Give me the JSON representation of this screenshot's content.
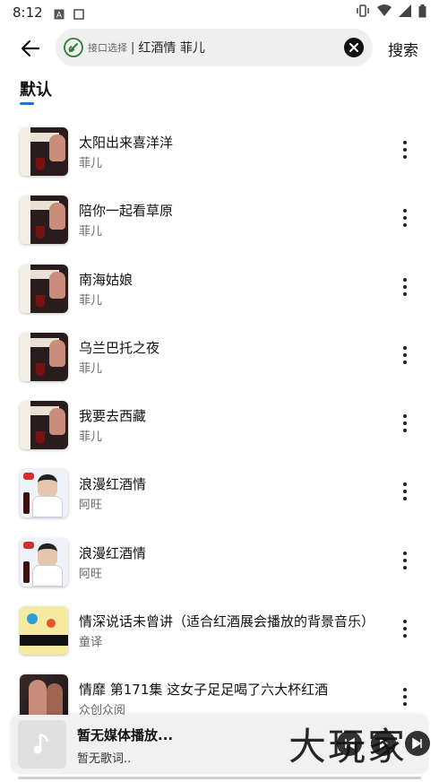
{
  "status_bar": {
    "time": "8:12"
  },
  "search": {
    "source_label": "接口选择",
    "separator": "|",
    "query": "红酒情 菲儿",
    "submit_label": "搜索"
  },
  "tabs": [
    {
      "label": "默认",
      "active": true
    }
  ],
  "songs": [
    {
      "title": "太阳出来喜洋洋",
      "artist": "菲儿",
      "cover": "cov-a"
    },
    {
      "title": "陪你一起看草原",
      "artist": "菲儿",
      "cover": "cov-a"
    },
    {
      "title": "南海姑娘",
      "artist": "菲儿",
      "cover": "cov-a"
    },
    {
      "title": "乌兰巴托之夜",
      "artist": "菲儿",
      "cover": "cov-a"
    },
    {
      "title": "我要去西藏",
      "artist": "菲儿",
      "cover": "cov-a"
    },
    {
      "title": "浪漫红酒情",
      "artist": "阿旺",
      "cover": "cov-b"
    },
    {
      "title": "浪漫红酒情",
      "artist": "阿旺",
      "cover": "cov-b"
    },
    {
      "title": "情深说话未曾讲（适合红酒展会播放的背景音乐）",
      "artist": "童译",
      "cover": "cov-c"
    },
    {
      "title": "情靡 第171集 这女子足足喝了六大杯红酒",
      "artist": "众创众阅",
      "cover": "cov-d"
    }
  ],
  "player": {
    "title": "暂无媒体播放...",
    "lyric": "暂无歌词..",
    "watermark": "大玩家"
  },
  "colors": {
    "accent": "#1976d2",
    "search_bg": "#efefef",
    "player_bg": "#f1f1f1"
  }
}
